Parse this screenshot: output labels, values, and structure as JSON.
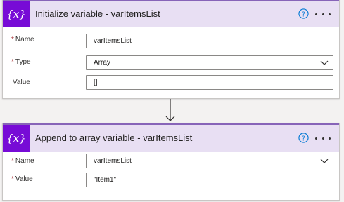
{
  "cards": [
    {
      "title": "Initialize variable - varItemsList",
      "fields": [
        {
          "label": "Name",
          "required": "*",
          "value": "varItemsList"
        },
        {
          "label": "Type",
          "required": "*",
          "value": "Array"
        },
        {
          "label": "Value",
          "required": "",
          "value": "[]"
        }
      ]
    },
    {
      "title": "Append to array variable - varItemsList",
      "fields": [
        {
          "label": "Name",
          "required": "*",
          "value": "varItemsList"
        },
        {
          "label": "Value",
          "required": "*",
          "value": "\"Item1\""
        }
      ]
    }
  ],
  "icons": {
    "variable": "variable-icon",
    "help": "help-icon",
    "more": "more-options-icon",
    "dropdown": "chevron-down-icon",
    "arrow": "arrow-down-icon"
  },
  "colors": {
    "accent": "#770bd6",
    "header_bg": "#e8dff3",
    "help_blue": "#0078d4",
    "required": "#a4262c"
  }
}
